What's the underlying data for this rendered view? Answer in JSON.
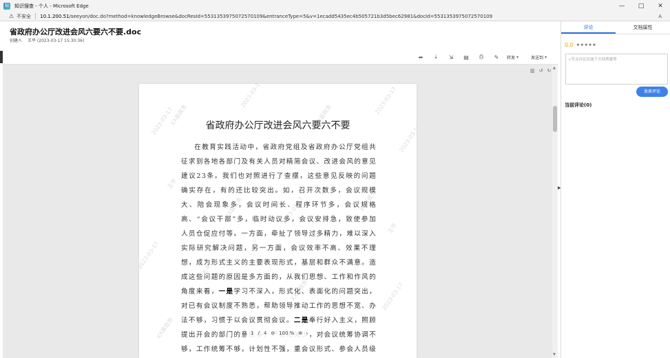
{
  "window": {
    "title": "知识搜查 - 个人 - Microsoft Edge",
    "controls": [
      "—",
      "□",
      "✕"
    ]
  },
  "address_bar": {
    "warning_icon": "warning-icon",
    "insecure_label": "不安全",
    "url_host": "10.1.200.51",
    "url_path": "/seeyon/doc.do?method=knowledgeBrowse&docResId=5531353975072570109&entranceType=5&v=1ecadd5435ec4b505721b3d5bec62981&docId=5531353975072570109"
  },
  "document": {
    "title": "省政府办公厅改进会风六要六不要.doc",
    "creator_label": "创建人",
    "creator_value": "王平 (2023-03-17 15:30:36)"
  },
  "toolbar": {
    "forward_label": "转发",
    "send_label": "发送到",
    "caret": "▾"
  },
  "page": {
    "heading": "省政府办公厅改进会风六要六不要",
    "para1": "在教育实践活动中，省政府党组及省政府办公厅党组共征求到各地各部门及有关人员对精简会议、改进会风的意见建议23条。我们也对照进行了查摆，这些意见反映的问题确实存在，有的还比较突出。如，召开次数多，会议规模大、陪会现象多，会议时间长、程序环节多，会议规格高、“会议干部”多，临时动议多，会议安排急，致使参加人员仓促应付等。一方面，牵扯了领导过多精力，难以深入实际研究解决问题，另一方面，会议效率不高、效果不理想，成为形式主义的主要表现形式，基层和群众不满意。造成这些问题的原因是多方面的，从我们思想、工作和作风的角度来看，",
    "bold1": "一是",
    "para2": "学习不深入，形式化、表面化的问题突出，对已有会议制度不熟悉，帮助领导推动工作的思想不宽、办法不够，习惯于以会议贯彻会议。",
    "bold2": "二是",
    "para3": "奉行好入主义，照顾提出开会的部门的意愿多，严格把关少，对会议统筹协调不够，工作统筹不够，计划性不强，重会议形式、参会人员级别和各种场面，对会",
    "watermark_org": "XX县政务",
    "watermark_date": "2023-03-17",
    "watermark_name": "王平"
  },
  "pager": {
    "current": "1",
    "slash": "/",
    "total": "4",
    "zoom_out": "⊖",
    "zoom": "100 %",
    "zoom_in": "⊕"
  },
  "right_panel": {
    "tab_comment": "评论",
    "tab_props": "文档属性",
    "score": "0.0",
    "stars": "★★★★★",
    "comment_placeholder": "<写点评论实施下文档质量等",
    "publish_button": "发表评论",
    "current_comments": "当前评论(0)"
  }
}
